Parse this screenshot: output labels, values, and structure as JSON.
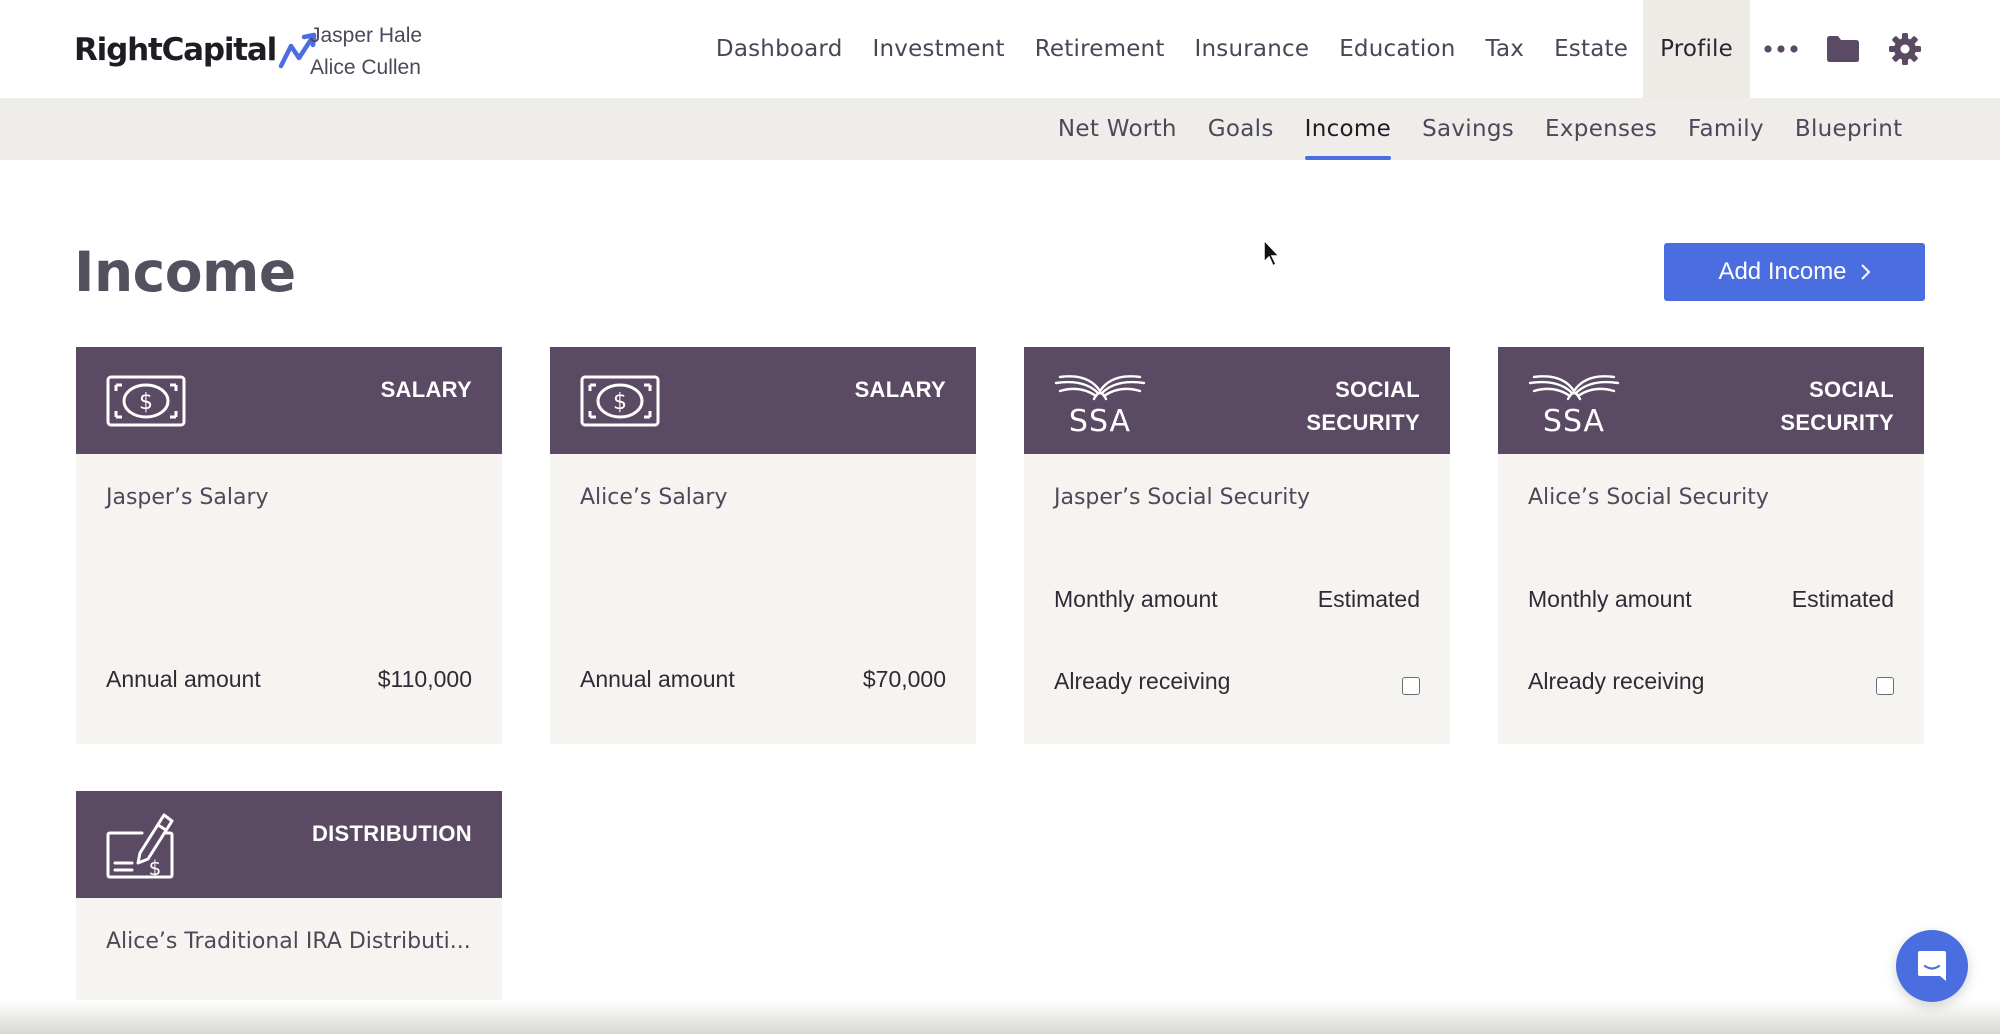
{
  "app": {
    "brand": "RightCapital",
    "clients": [
      "Jasper Hale",
      "Alice Cullen"
    ]
  },
  "main_nav": {
    "items": [
      {
        "label": "Dashboard",
        "active": false
      },
      {
        "label": "Investment",
        "active": false
      },
      {
        "label": "Retirement",
        "active": false
      },
      {
        "label": "Insurance",
        "active": false
      },
      {
        "label": "Education",
        "active": false
      },
      {
        "label": "Tax",
        "active": false
      },
      {
        "label": "Estate",
        "active": false
      },
      {
        "label": "Profile",
        "active": true
      }
    ],
    "more_icon": "more-dots-icon",
    "folder_icon": "folder-icon",
    "settings_icon": "gear-icon"
  },
  "sub_nav": {
    "items": [
      {
        "label": "Net Worth",
        "active": false
      },
      {
        "label": "Goals",
        "active": false
      },
      {
        "label": "Income",
        "active": true
      },
      {
        "label": "Savings",
        "active": false
      },
      {
        "label": "Expenses",
        "active": false
      },
      {
        "label": "Family",
        "active": false
      },
      {
        "label": "Blueprint",
        "active": false
      }
    ]
  },
  "page": {
    "title": "Income",
    "add_button": "Add Income"
  },
  "cards": [
    {
      "type": "SALARY",
      "icon": "dollar-bill-icon",
      "name": "Jasper’s Salary",
      "row1_label": "Annual amount",
      "row1_value": "$110,000"
    },
    {
      "type": "SALARY",
      "icon": "dollar-bill-icon",
      "name": "Alice’s Salary",
      "row1_label": "Annual amount",
      "row1_value": "$70,000"
    },
    {
      "type_line1": "SOCIAL",
      "type_line2": "SECURITY",
      "icon": "ssa-logo-icon",
      "logo_text": "SSA",
      "name": "Jasper’s Social Security",
      "row1_label": "Monthly amount",
      "row1_value": "Estimated",
      "row2_label": "Already receiving",
      "already_receiving": false
    },
    {
      "type_line1": "SOCIAL",
      "type_line2": "SECURITY",
      "icon": "ssa-logo-icon",
      "logo_text": "SSA",
      "name": "Alice’s Social Security",
      "row1_label": "Monthly amount",
      "row1_value": "Estimated",
      "row2_label": "Already receiving",
      "already_receiving": false
    },
    {
      "type": "DISTRIBUTION",
      "icon": "check-signing-icon",
      "name": "Alice’s Traditional IRA Distributi..."
    }
  ],
  "colors": {
    "accent": "#4a6ee0",
    "card_header": "#5a4a63",
    "card_body": "#f6f4f0",
    "subnav_bg": "#eeede9"
  },
  "chat_icon": "chat-bubble-icon"
}
